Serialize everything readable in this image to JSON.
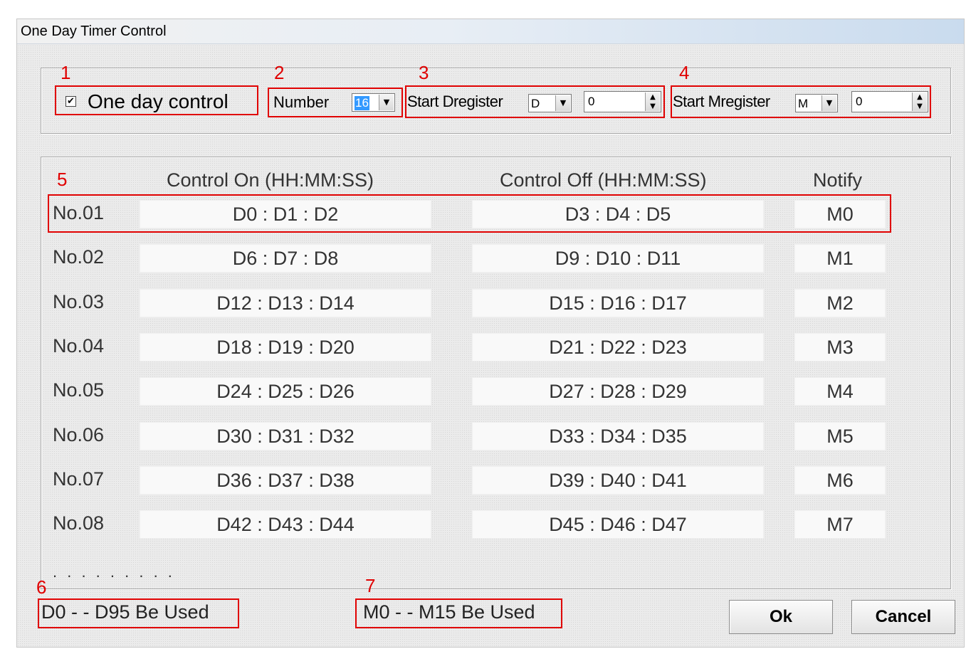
{
  "window": {
    "title": "One Day Timer Control"
  },
  "annotations": [
    "1",
    "2",
    "3",
    "4",
    "5",
    "6",
    "7"
  ],
  "controls": {
    "one_day_control": {
      "label": "One day control",
      "checked": true,
      "check_glyph": "✔"
    },
    "number": {
      "label": "Number",
      "value": "16"
    },
    "start_d": {
      "label": "Start Dregister",
      "type": "D",
      "value": "0"
    },
    "start_m": {
      "label": "Start Mregister",
      "type": "M",
      "value": "0"
    }
  },
  "table": {
    "headers": {
      "on": "Control On (HH:MM:SS)",
      "off": "Control Off (HH:MM:SS)",
      "notify": "Notify"
    },
    "rows": [
      {
        "label": "No.01",
        "on": "D0 : D1 : D2",
        "off": "D3 : D4 : D5",
        "notify": "M0"
      },
      {
        "label": "No.02",
        "on": "D6 : D7 : D8",
        "off": "D9 : D10 : D11",
        "notify": "M1"
      },
      {
        "label": "No.03",
        "on": "D12 : D13 : D14",
        "off": "D15 : D16 : D17",
        "notify": "M2"
      },
      {
        "label": "No.04",
        "on": "D18 : D19 : D20",
        "off": "D21 : D22 : D23",
        "notify": "M3"
      },
      {
        "label": "No.05",
        "on": "D24 : D25 : D26",
        "off": "D27 : D28 : D29",
        "notify": "M4"
      },
      {
        "label": "No.06",
        "on": "D30 : D31 : D32",
        "off": "D33 : D34 : D35",
        "notify": "M5"
      },
      {
        "label": "No.07",
        "on": "D36 : D37 : D38",
        "off": "D39 : D40 : D41",
        "notify": "M6"
      },
      {
        "label": "No.08",
        "on": "D42 : D43 : D44",
        "off": "D45 : D46 : D47",
        "notify": "M7"
      }
    ],
    "ellipsis": ". . . . . . . . ."
  },
  "status": {
    "d_range": "D0 - - D95 Be Used",
    "m_range": "M0 - - M15 Be Used"
  },
  "buttons": {
    "ok": "Ok",
    "cancel": "Cancel"
  },
  "colors": {
    "annotation": "#e00000",
    "selection": "#3399ff",
    "title_gradient_end": "#c9dbee"
  }
}
